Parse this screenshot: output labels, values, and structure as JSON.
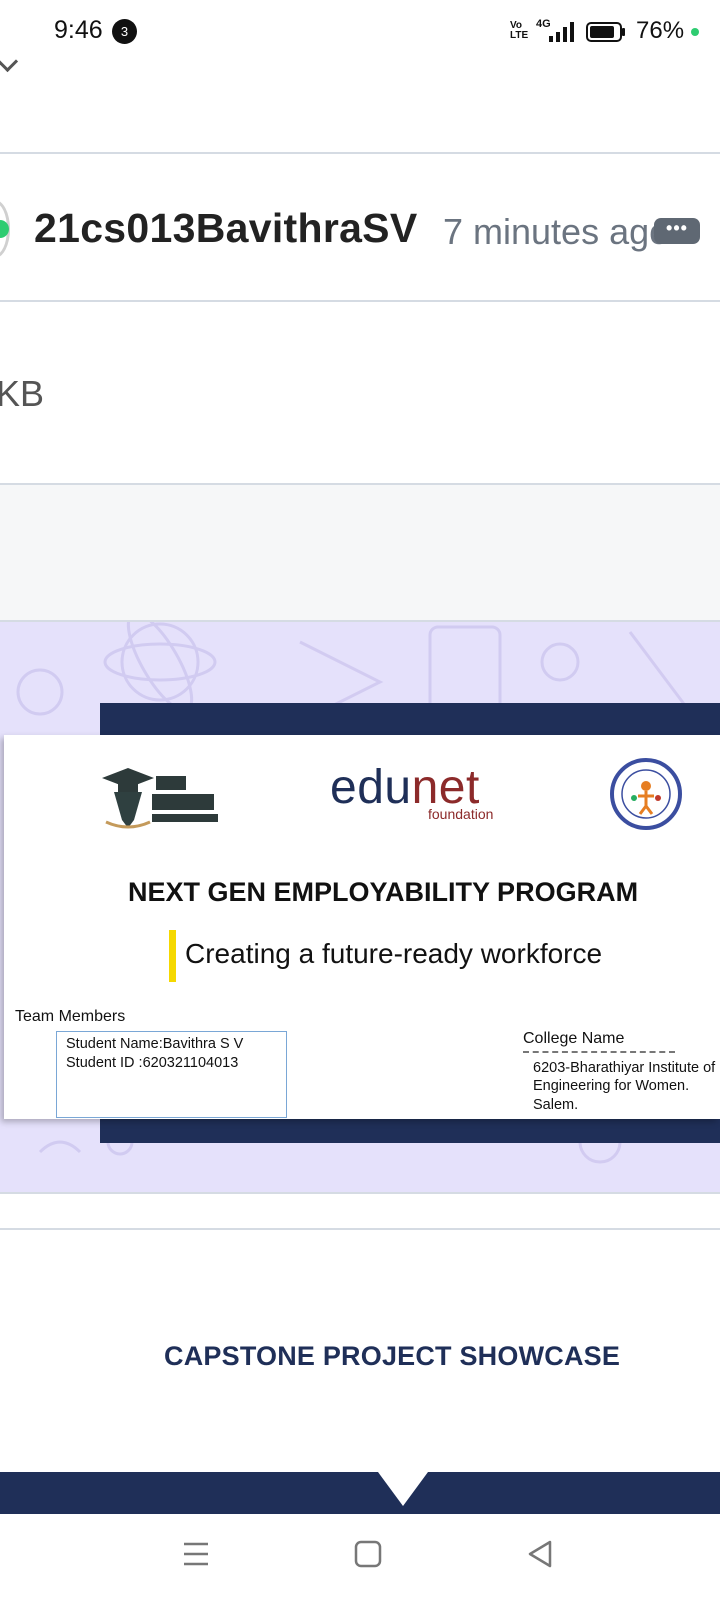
{
  "status_bar": {
    "time": "9:46",
    "notification_count": "3",
    "volte": "Vo\nLTE",
    "network": "4G",
    "battery_percent": "76%",
    "dot_color": "#2ecc71"
  },
  "post": {
    "username": "21cs013BavithraSV",
    "time_ago": "7 minutes ago",
    "more_label": "•••",
    "file_size": "KB"
  },
  "slide": {
    "edunet": {
      "part1": "edu",
      "part2": "net",
      "sub": "foundation"
    },
    "program_title": "NEXT GEN EMPLOYABILITY PROGRAM",
    "tagline": "Creating a future-ready workforce",
    "team_label": "Team Members",
    "student_name": "Student Name:Bavithra S V",
    "student_id": "Student ID :620321104013",
    "college_label": "College Name",
    "college_lines": [
      "6203-Bharathiyar Institute of",
      "Engineering for Women.",
      "Salem."
    ],
    "logos": [
      "naan-mudhalvan-logo",
      "edunet-logo",
      "tn-skill-development-seal"
    ]
  },
  "next_slide": {
    "title": "CAPSTONE PROJECT SHOWCASE"
  },
  "colors": {
    "navy": "#1f2f58",
    "lavender": "#e5e1fb",
    "edunet_red": "#8c2a2a",
    "accent_yellow": "#f5d800"
  },
  "nav_bar": {
    "icons": [
      "menu-icon",
      "home-square-icon",
      "back-triangle-icon"
    ]
  }
}
